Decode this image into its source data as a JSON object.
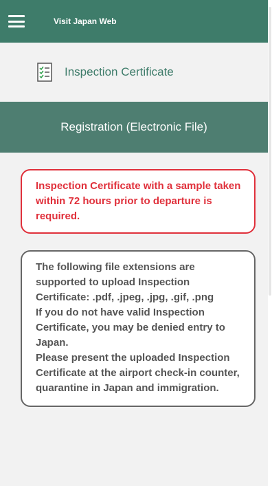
{
  "header": {
    "brand": "Visit Japan Web",
    "menu_icon": "hamburger-menu-icon"
  },
  "page": {
    "title": "Inspection Certificate",
    "title_icon": "checklist-document-icon"
  },
  "section": {
    "header": "Registration (Electronic File)"
  },
  "alert": {
    "text": "Inspection Certificate with a sample taken within 72 hours prior to departure is required."
  },
  "info": {
    "extensions": "The following file extensions are supported to upload Inspection Certificate: .pdf, .jpeg, .jpg, .gif, .png",
    "warning": "If you do not have valid Inspection Certificate, you may be denied entry to Japan.",
    "instruction": "Please present the uploaded Inspection Certificate at the airport check-in counter, quarantine in Japan and immigration."
  },
  "colors": {
    "brand_green": "#3e7c6a",
    "section_green": "#4e7e71",
    "alert_red": "#e0303b",
    "info_gray": "#555555"
  }
}
